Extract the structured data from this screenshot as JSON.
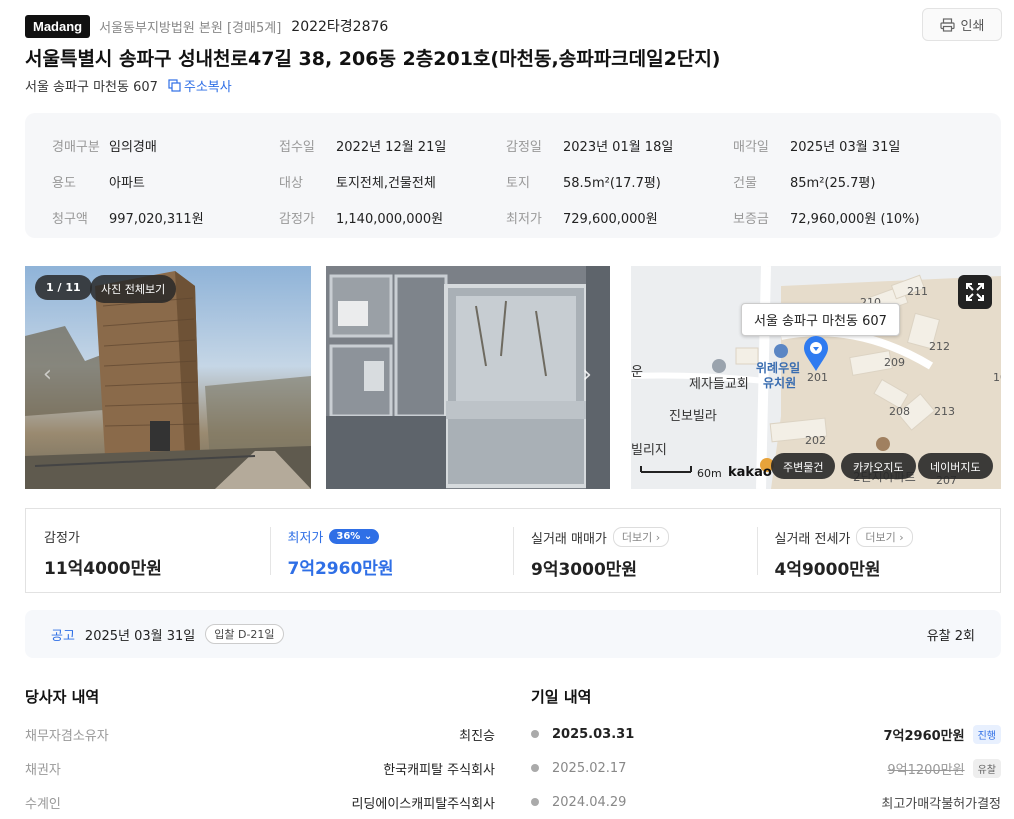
{
  "header": {
    "brand": "Madang",
    "court": "서울동부지방법원 본원 [경매5계]",
    "case_no": "2022타경2876",
    "print_label": "인쇄"
  },
  "title": "서울특별시 송파구 성내천로47길 38, 206동 2층201호(마천동,송파파크데일2단지)",
  "sub_address": "서울 송파구 마천동 607",
  "copy_label": "주소복사",
  "info": [
    {
      "k": "경매구분",
      "v": "임의경매"
    },
    {
      "k": "접수일",
      "v": "2022년 12월 21일"
    },
    {
      "k": "감정일",
      "v": "2023년 01월 18일"
    },
    {
      "k": "매각일",
      "v": "2025년 03월 31일"
    },
    {
      "k": "용도",
      "v": "아파트"
    },
    {
      "k": "대상",
      "v": "토지전체,건물전체"
    },
    {
      "k": "토지",
      "v": "58.5m²(17.7평)"
    },
    {
      "k": "건물",
      "v": "85m²(25.7평)"
    },
    {
      "k": "청구액",
      "v": "997,020,311원"
    },
    {
      "k": "감정가",
      "v": "1,140,000,000원"
    },
    {
      "k": "최저가",
      "v": "729,600,000원"
    },
    {
      "k": "보증금",
      "v": "72,960,000원 (10%)"
    }
  ],
  "photos": {
    "counter": "1 / 11",
    "view_all": "사진 전체보기"
  },
  "map": {
    "address_label": "서울 송파구 마천동 607",
    "labels": [
      "위례우일",
      "유치원",
      "제자들교회",
      "진보빌라",
      "빌리지",
      "201",
      "202",
      "208",
      "209",
      "210",
      "211",
      "212",
      "213",
      "207",
      "2단지아파트"
    ],
    "scale": "60m",
    "kakao": "kakao",
    "btn_nearby": "주변물건",
    "btn_kakao": "카카오지도",
    "btn_naver": "네이버지도"
  },
  "prices": [
    {
      "label": "감정가",
      "value": "11억4000만원"
    },
    {
      "label": "최저가",
      "tag": "36%",
      "value": "7억2960만원"
    },
    {
      "label": "실거래 매매가",
      "more": "더보기",
      "value": "9억3000만원"
    },
    {
      "label": "실거래 전세가",
      "more": "더보기",
      "value": "4억9000만원"
    }
  ],
  "notice": {
    "label": "공고",
    "date": "2025년 03월 31일",
    "dday": "입찰 D-21일",
    "fail_count": "유찰 2회"
  },
  "parties": {
    "title": "당사자 내역",
    "rows": [
      {
        "k": "채무자겸소유자",
        "v": "최진승"
      },
      {
        "k": "채권자",
        "v": "한국캐피탈 주식회사"
      },
      {
        "k": "수계인",
        "v": "리딩에이스캐피탈주식회사"
      }
    ]
  },
  "history": {
    "title": "기일 내역",
    "rows": [
      {
        "date": "2025.03.31",
        "amount": "7억2960만원",
        "status": "진행"
      },
      {
        "date": "2025.02.17",
        "amount": "9억1200만원",
        "status": "유찰"
      },
      {
        "date": "2024.04.29",
        "amount": "최고가매각불허가결정",
        "status": ""
      }
    ]
  },
  "colors": {
    "accent": "#2f6fe6",
    "marker": "#2f7bf0"
  }
}
